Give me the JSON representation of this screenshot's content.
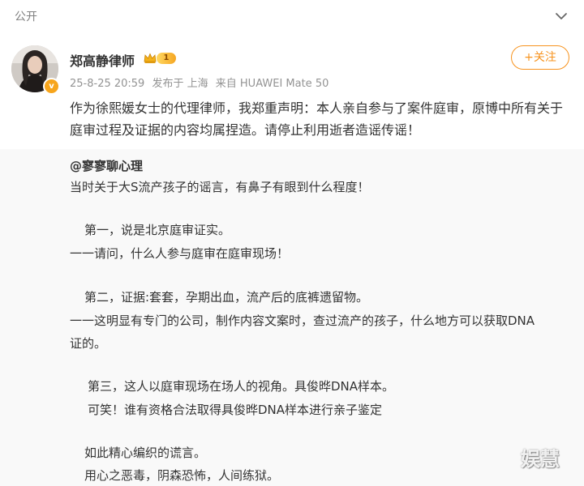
{
  "header": {
    "visibility": "公开"
  },
  "post": {
    "author_name": "郑高静律师",
    "level": "1",
    "meta": {
      "timestamp": "25-8-25 20:59",
      "location": "发布于 上海",
      "source": "来自 HUAWEI Mate 50"
    },
    "follow_label": "+关注",
    "text": "作为徐熙媛女士的代理律师，我郑重声明：本人亲自参与了案件庭审，原博中所有关于庭审过程及证据的内容均属捏造。请停止利用逝者造谣传谣！"
  },
  "repost": {
    "author": "@寥寥聊心理",
    "lines": [
      "当时关于大S流产孩子的谣言，有鼻子有眼到什么程度！",
      "第一，说是北京庭审证实。",
      "一一请问，什么人参与庭审在庭审现场！",
      "第二，证据:套套，孕期出血，流产后的底裤遗留物。",
      "一一这明显有专门的公司，制作内容文案时，查过流产的孩子，什么地方可以获取DNA",
      "证的。",
      "第三，这人以庭审现场在场人的视角。具俊晔DNA样本。",
      "可笑！谁有资格合法取得具俊晔DNA样本进行亲子鉴定",
      "如此精心编织的谎言。",
      "用心之恶毒，阴森恐怖，人间练狱。"
    ]
  },
  "watermark": "娱慧",
  "colors": {
    "accent": "#f7931e",
    "meta_text": "#939393",
    "repost_bg": "#f9f9f9"
  }
}
